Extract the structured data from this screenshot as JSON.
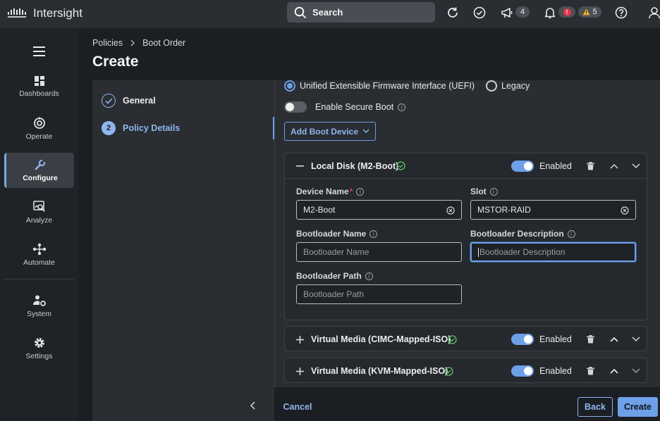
{
  "app": {
    "brand": "Intersight",
    "logo": "cisco-logo"
  },
  "header": {
    "search_placeholder": "Search",
    "announcements_count": "4",
    "alarms_critical_count": "",
    "alarms_warning_count": "5"
  },
  "sidebar": {
    "items": [
      {
        "label": "Dashboards",
        "icon": "dashboards-icon"
      },
      {
        "label": "Operate",
        "icon": "operate-icon"
      },
      {
        "label": "Configure",
        "icon": "configure-icon",
        "active": true
      },
      {
        "label": "Analyze",
        "icon": "analyze-icon"
      },
      {
        "label": "Automate",
        "icon": "automate-icon"
      },
      {
        "label": "System",
        "icon": "system-icon"
      },
      {
        "label": "Settings",
        "icon": "settings-icon"
      }
    ]
  },
  "breadcrumb": {
    "items": [
      "Policies",
      "Boot Order"
    ]
  },
  "page": {
    "title": "Create"
  },
  "wizard": {
    "steps": [
      {
        "number": "",
        "label": "General",
        "state": "complete"
      },
      {
        "number": "2",
        "label": "Policy Details",
        "state": "current"
      }
    ]
  },
  "boot_mode": {
    "uefi_label": "Unified Extensible Firmware Interface (UEFI)",
    "legacy_label": "Legacy",
    "selected": "uefi",
    "secure_boot_label": "Enable Secure Boot",
    "secure_boot_enabled": false
  },
  "add_boot_device": {
    "label": "Add Boot Device"
  },
  "devices": [
    {
      "title": "Local Disk (M2-Boot)",
      "enabled_label": "Enabled",
      "expanded": true,
      "fields": {
        "device_name_label": "Device Name",
        "device_name_value": "M2-Boot",
        "slot_label": "Slot",
        "slot_value": "MSTOR-RAID",
        "bootloader_name_label": "Bootloader Name",
        "bootloader_name_placeholder": "Bootloader Name",
        "bootloader_desc_label": "Bootloader Description",
        "bootloader_desc_placeholder": "Bootloader Description",
        "bootloader_path_label": "Bootloader Path",
        "bootloader_path_placeholder": "Bootloader Path"
      }
    },
    {
      "title": "Virtual Media (CIMC-Mapped-ISO)",
      "enabled_label": "Enabled",
      "expanded": false
    },
    {
      "title": "Virtual Media (KVM-Mapped-ISO)",
      "enabled_label": "Enabled",
      "expanded": false
    }
  ],
  "footer": {
    "cancel_label": "Cancel",
    "back_label": "Back",
    "create_label": "Create"
  },
  "colors": {
    "accent": "#6ea0e8",
    "success": "#5cc56a",
    "critical": "#e0374c",
    "warning": "#f0b429"
  }
}
